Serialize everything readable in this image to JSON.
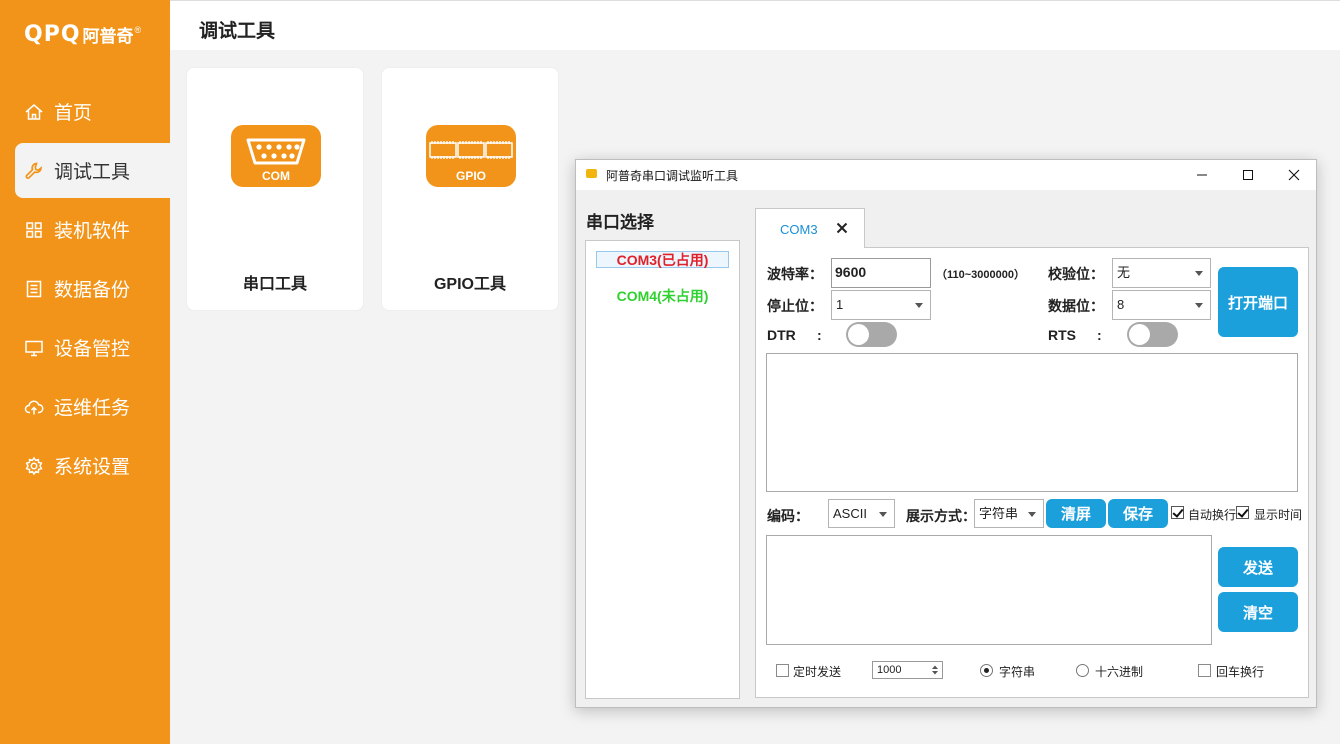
{
  "brand": {
    "mark": "QPQ",
    "text": "阿普奇",
    "reg": "®",
    "color": "#f29419"
  },
  "sidebar": {
    "items": [
      {
        "label": "首页",
        "icon": "home-icon"
      },
      {
        "label": "调试工具",
        "icon": "wrench-icon",
        "active": true
      },
      {
        "label": "装机软件",
        "icon": "grid-icon"
      },
      {
        "label": "数据备份",
        "icon": "document-icon"
      },
      {
        "label": "设备管控",
        "icon": "monitor-icon"
      },
      {
        "label": "运维任务",
        "icon": "cloud-upload-icon"
      },
      {
        "label": "系统设置",
        "icon": "gear-icon"
      }
    ]
  },
  "header": {
    "title": "调试工具"
  },
  "tools": [
    {
      "label": "串口工具",
      "icon_text": "COM",
      "icon": "serial-port-icon"
    },
    {
      "label": "GPIO工具",
      "icon_text": "GPIO",
      "icon": "gpio-icon"
    }
  ],
  "dialog": {
    "title": "阿普奇串口调试监听工具",
    "port_heading": "串口选择",
    "ports": [
      {
        "label": "COM3(已占用)",
        "color": "#e0202a",
        "selected": true
      },
      {
        "label": "COM4(未占用)",
        "color": "#2fd12f",
        "selected": false
      }
    ],
    "tab": {
      "label": "COM3"
    },
    "form": {
      "baud_label": "波特率：",
      "baud_value": "9600",
      "baud_hint": "（110~3000000）",
      "parity_label": "校验位：",
      "parity_value": "无",
      "stop_label": "停止位：",
      "stop_value": "1",
      "data_label": "数据位：",
      "data_value": "8",
      "dtr_label": "DTR",
      "rts_label": "RTS",
      "colon": ":",
      "dtr_on": false,
      "rts_on": false,
      "open_button": "打开端口"
    },
    "display": {
      "encoding_label": "编码：",
      "encoding_value": "ASCII",
      "mode_label": "展示方式：",
      "mode_value": "字符串",
      "clear_screen": "清屏",
      "save": "保存",
      "auto_wrap": "自动换行",
      "auto_wrap_checked": true,
      "show_time": "显示时间",
      "show_time_checked": true
    },
    "send": {
      "send_button": "发送",
      "clear_button": "清空",
      "timed_send": "定时发送",
      "timed_send_checked": false,
      "interval": "1000",
      "string_mode": "字符串",
      "hex_mode": "十六进制",
      "selected_mode": "字符串",
      "newline": "回车换行",
      "newline_checked": false
    }
  },
  "accent": "#1ca0dc"
}
